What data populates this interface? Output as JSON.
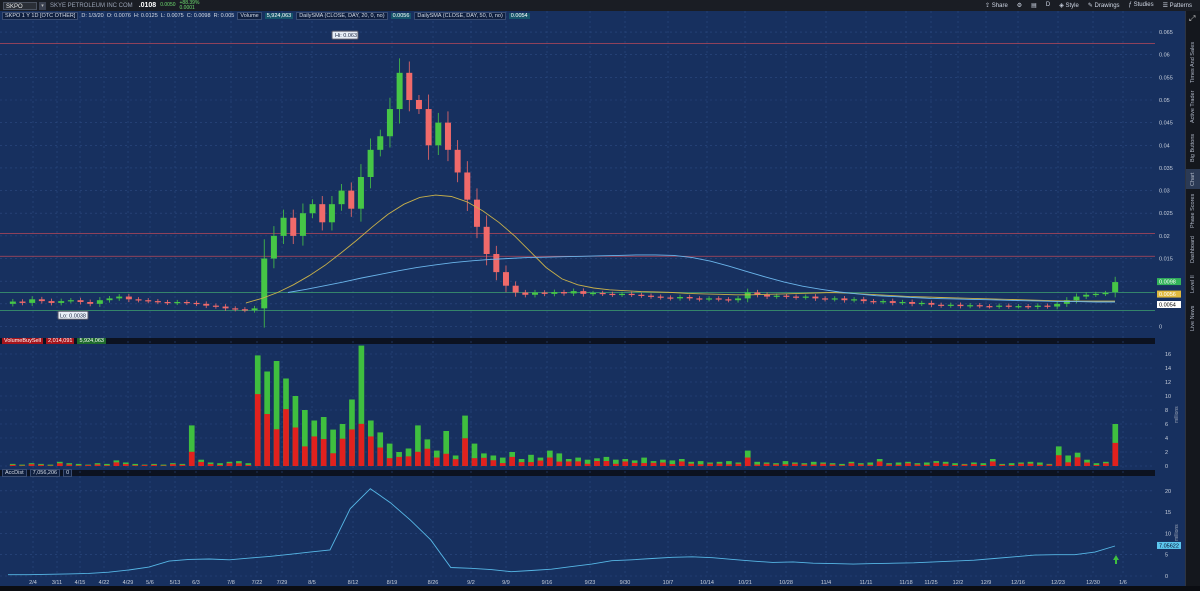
{
  "topbar": {
    "symbol": "SKPO",
    "company": "SKYE PETROLEUM INC COM",
    "last": ".0108",
    "change_lines": [
      "0.0050",
      "+88.39%",
      "0.0001"
    ],
    "tools": {
      "share": "Share",
      "style": "Style",
      "drawings": "Drawings",
      "studies": "Studies",
      "patterns": "Patterns",
      "aggregation": "D"
    }
  },
  "price_header": {
    "title": "SKPO 1 Y 1D [OTC OTHER]",
    "d": "D: 1/3/20",
    "o": "O: 0.0076",
    "h": "H: 0.0125",
    "l": "L: 0.0075",
    "c": "C: 0.0098",
    "r": "R: 0.005",
    "volume_label": "Volume",
    "volume_value": "5,924,063",
    "sma20_label": "DailySMA (CLOSE, DAY, 20, 0, no)",
    "sma20_value": "0.0056",
    "sma50_label": "DailySMA (CLOSE, DAY, 50, 0, no)",
    "sma50_value": "0.0054"
  },
  "hi_label": "Hi: 0.063",
  "lo_label": "Lo: 0.0038",
  "price_right_labels": [
    {
      "text": "0.0098",
      "color": "#32b35a"
    },
    {
      "text": "0.0056",
      "color": "#e0b93e"
    },
    {
      "text": "0.0054",
      "color": "#ffffff"
    }
  ],
  "volume_header": {
    "title": "VolumeBuySell",
    "sell": "2,014,091",
    "buy": "5,924,063"
  },
  "accdist_header": {
    "title": "AccDist",
    "value": "7,056,206",
    "zero": "0"
  },
  "accdist_right_label": "7.05622",
  "pane_side_labels": [
    "millions",
    "millions"
  ],
  "sidetabs": [
    "Live News",
    "Level II",
    "Dashboard",
    "Phase Scores",
    "Chart",
    "Big Buttons",
    "Active Trader",
    "Times And Sales"
  ],
  "colors": {
    "background": "#17305f",
    "up_candle": "#46c646",
    "down_candle": "#f06a6a",
    "sma20": "#c8b04a",
    "sma50": "#6ab4ea",
    "accdist": "#56b7e6",
    "volume_buy": "#3fbf3f",
    "volume_sell": "#e1211e"
  },
  "chart_data": [
    {
      "type": "candlestick",
      "title": "SKPO 1 Y 1D [OTC OTHER]",
      "ylim": [
        -0.001,
        0.067
      ],
      "y_ticks": [
        0,
        0.005,
        0.01,
        0.015,
        0.02,
        0.025,
        0.03,
        0.035,
        0.04,
        0.045,
        0.05,
        0.055,
        0.06,
        0.065
      ],
      "y_tick_labels": [
        "0",
        "0.005",
        "0.01",
        "0.015",
        "0.02",
        "0.025",
        "0.03",
        "0.035",
        "0.04",
        "0.045",
        "0.05",
        "0.055",
        "0.06",
        "0.065"
      ],
      "x_tick_labels": [
        "2/4",
        "3/11",
        "4/15",
        "4/22",
        "4/29",
        "5/6",
        "5/13",
        "6/3",
        "7/8",
        "7/22",
        "7/29",
        "8/5",
        "8/12",
        "8/19",
        "8/26",
        "9/2",
        "9/9",
        "9/16",
        "9/23",
        "9/30",
        "10/7",
        "10/14",
        "10/21",
        "10/28",
        "11/4",
        "11/11",
        "11/18",
        "11/25",
        "12/2",
        "12/9",
        "12/16",
        "12/23",
        "12/30",
        "1/6"
      ],
      "horizontal_levels": [
        0.0625,
        0.0205,
        0.0155,
        0.0075,
        0.0035
      ],
      "series": [
        {
          "name": "DailySMA (CLOSE, DAY, 20, 0, no)",
          "values": [
            0.0052,
            0.0062,
            0.0075,
            0.0092,
            0.0112,
            0.0135,
            0.0162,
            0.019,
            0.022,
            0.0248,
            0.027,
            0.0285,
            0.029,
            0.0287,
            0.0275,
            0.0255,
            0.023,
            0.02,
            0.0165,
            0.013,
            0.0105,
            0.0092,
            0.0085,
            0.0081,
            0.0079,
            0.0077,
            0.0076,
            0.0075,
            0.0073,
            0.0072,
            0.0071,
            0.007,
            0.007,
            0.0071,
            0.0072,
            0.0073,
            0.0074,
            0.0075,
            0.0074,
            0.0072,
            0.007,
            0.0068,
            0.0066,
            0.0065,
            0.0064,
            0.0063,
            0.0062,
            0.0061,
            0.006,
            0.0059,
            0.0058,
            0.0057,
            0.0056,
            0.0056,
            0.0056,
            0.0056
          ]
        },
        {
          "name": "DailySMA (CLOSE, DAY, 50, 0, no)",
          "values": [
            0.0075,
            0.0082,
            0.009,
            0.0098,
            0.0107,
            0.0115,
            0.0123,
            0.013,
            0.0136,
            0.0141,
            0.0145,
            0.0148,
            0.015,
            0.0152,
            0.0153,
            0.0154,
            0.0155,
            0.0156,
            0.0157,
            0.0158,
            0.0158,
            0.0157,
            0.0152,
            0.0144,
            0.0133,
            0.0121,
            0.0109,
            0.0098,
            0.0089,
            0.0082,
            0.0076,
            0.0072,
            0.0068,
            0.0066,
            0.0064,
            0.0062,
            0.0061,
            0.006,
            0.0059,
            0.0058,
            0.0057,
            0.0056,
            0.0055,
            0.0055,
            0.0054,
            0.0054
          ]
        }
      ]
    },
    {
      "type": "bar",
      "title": "VolumeBuySell",
      "ylabel": "millions",
      "ylim": [
        0,
        17
      ],
      "y_ticks": [
        0,
        2,
        4,
        6,
        8,
        10,
        12,
        14,
        16
      ]
    },
    {
      "type": "line",
      "title": "AccDist",
      "ylabel": "millions",
      "ylim": [
        0,
        23
      ],
      "y_ticks": [
        0,
        5,
        10,
        15,
        20
      ],
      "values": [
        0.3,
        0.3,
        0.4,
        0.5,
        0.6,
        0.9,
        1.4,
        2.1,
        3.5,
        3.9,
        4.0,
        3.8,
        4.2,
        4.6,
        5.1,
        5.6,
        6.1,
        15.8,
        20.5,
        17.2,
        13.1,
        8.5,
        2.0,
        1.8,
        1.5,
        1.0,
        1.3,
        1.6,
        2.2,
        2.8,
        3.6,
        3.8,
        4.1,
        4.4,
        4.5,
        4.3,
        3.9,
        3.5,
        3.2,
        3.3,
        3.0,
        2.9,
        2.8,
        2.9,
        3.0,
        3.1,
        3.3,
        3.5,
        3.7,
        4.1,
        4.5,
        4.9,
        5.0,
        5.0,
        5.6,
        7.05
      ]
    }
  ]
}
